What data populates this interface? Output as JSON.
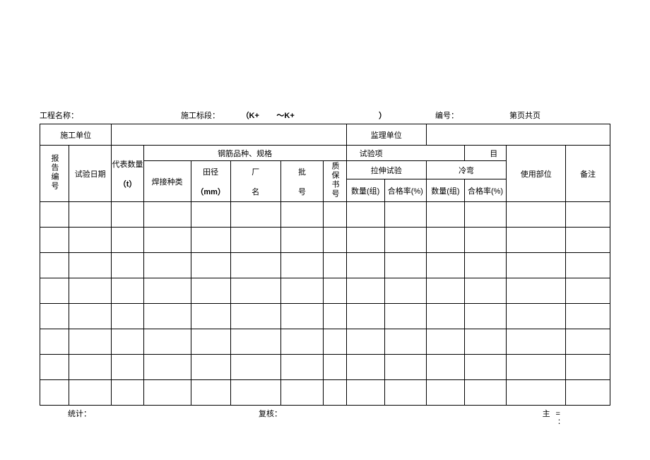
{
  "header": {
    "project_label": "工程名称：",
    "section_label": "施工标段：",
    "k_from": "（K+",
    "k_to": "～K+",
    "close_paren": "）",
    "number_label": "编号：",
    "page_label": "第页共页"
  },
  "table": {
    "construction_unit": "施工单位",
    "supervision_unit": "监理单位",
    "report_no": "报告编号",
    "test_date": "试验日期",
    "rep_qty": "代表数量",
    "rep_qty_unit": "（t）",
    "rebar_spec": "钢筋品种、规格",
    "test_item": "试验项",
    "test_item_end": "目",
    "weld_type": "焊接种类",
    "diameter": "田径",
    "diameter_unit": "（mm）",
    "factory": "厂",
    "factory_name": "名",
    "batch": "批",
    "batch_no": "号",
    "qc_cert": "质保书号",
    "tensile": "拉伸试验",
    "cold_bend": "冷弯",
    "qty_group": "数量(组)",
    "pass_rate": "合格率(%)",
    "use_part": "使用部位",
    "remark": "备注"
  },
  "footer": {
    "stat": "统计：",
    "check": "复核：",
    "main": "主="
  }
}
